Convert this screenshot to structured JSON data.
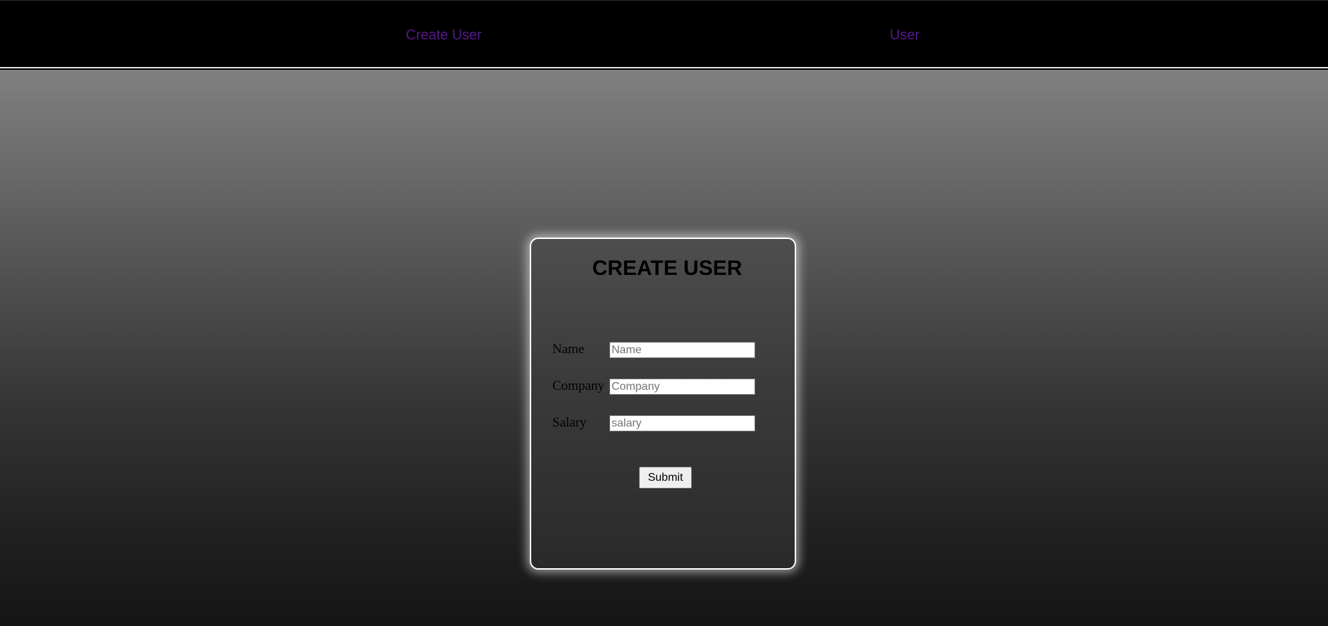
{
  "nav": {
    "links": [
      {
        "label": "Create User"
      },
      {
        "label": "User"
      }
    ],
    "link_color": "#551a8b"
  },
  "form": {
    "title": "CREATE USER",
    "fields": [
      {
        "label": "Name",
        "value": "",
        "placeholder": "Name"
      },
      {
        "label": "Company",
        "value": "",
        "placeholder": "Company"
      },
      {
        "label": "Salary",
        "value": "",
        "placeholder": "salary"
      }
    ],
    "submit_label": "Submit"
  }
}
